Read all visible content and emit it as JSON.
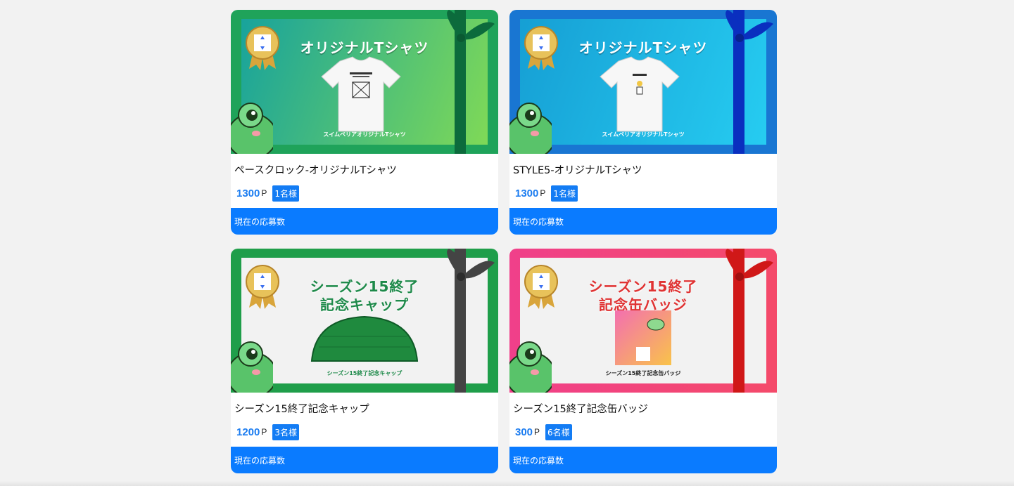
{
  "cards": [
    {
      "name": "ペースクロック-オリジナルTシャツ",
      "price": "1300",
      "unit": "P",
      "winners": "1名様",
      "apply_label": "現在の応募数",
      "promo_title_1": "オリジナルTシャツ",
      "promo_title_2": "",
      "promo_caption": "スイムペリアオリジナルTシャツ",
      "theme": {
        "outer": "#1fa35a",
        "inner_from": "#1ba99a",
        "inner_to": "#7ed957",
        "ribbon": "#0c6b3c"
      }
    },
    {
      "name": "STYLE5-オリジナルTシャツ",
      "price": "1300",
      "unit": "P",
      "winners": "1名様",
      "apply_label": "現在の応募数",
      "promo_title_1": "オリジナルTシャツ",
      "promo_title_2": "",
      "promo_caption": "スイムペリアオリジナルTシャツ",
      "theme": {
        "outer": "#1976d2",
        "inner_from": "#1aa7d8",
        "inner_to": "#23c9ef",
        "ribbon": "#0a2fbf"
      }
    },
    {
      "name": "シーズン15終了記念キャップ",
      "price": "1200",
      "unit": "P",
      "winners": "3名様",
      "apply_label": "現在の応募数",
      "promo_title_1": "シーズン15終了",
      "promo_title_2": "記念キャップ",
      "promo_caption": "シーズン15終了記念キャップ",
      "theme": {
        "outer": "#1f9e4a",
        "inner_from": "#f2f2f2",
        "inner_to": "#f2f2f2",
        "ribbon": "#444444"
      }
    },
    {
      "name": "シーズン15終了記念缶バッジ",
      "price": "300",
      "unit": "P",
      "winners": "6名様",
      "apply_label": "現在の応募数",
      "promo_title_1": "シーズン15終了",
      "promo_title_2": "記念缶バッジ",
      "promo_caption": "シーズン15終了記念缶バッジ",
      "theme": {
        "outer": "#ef3a7b",
        "inner_from": "#f2f2f2",
        "inner_to": "#f2f2f2",
        "ribbon": "#d01818"
      }
    }
  ]
}
